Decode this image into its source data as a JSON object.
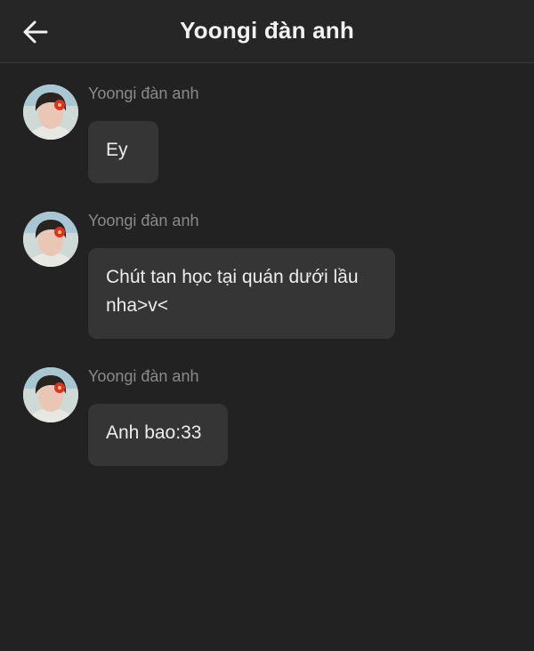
{
  "header": {
    "title": "Yoongi đàn anh",
    "back_icon": "arrow-left-icon"
  },
  "colors": {
    "background": "#222222",
    "bubble": "#353535",
    "sender_name": "#8a8a8a",
    "text": "#ededed"
  },
  "messages": [
    {
      "sender": "Yoongi đàn anh",
      "text": "Ey",
      "avatar_icon": "avatar-photo"
    },
    {
      "sender": "Yoongi đàn anh",
      "text": "Chút tan học tại quán dưới lầu\nnha>v<",
      "avatar_icon": "avatar-photo"
    },
    {
      "sender": "Yoongi đàn anh",
      "text": "Anh bao:33",
      "avatar_icon": "avatar-photo"
    }
  ]
}
